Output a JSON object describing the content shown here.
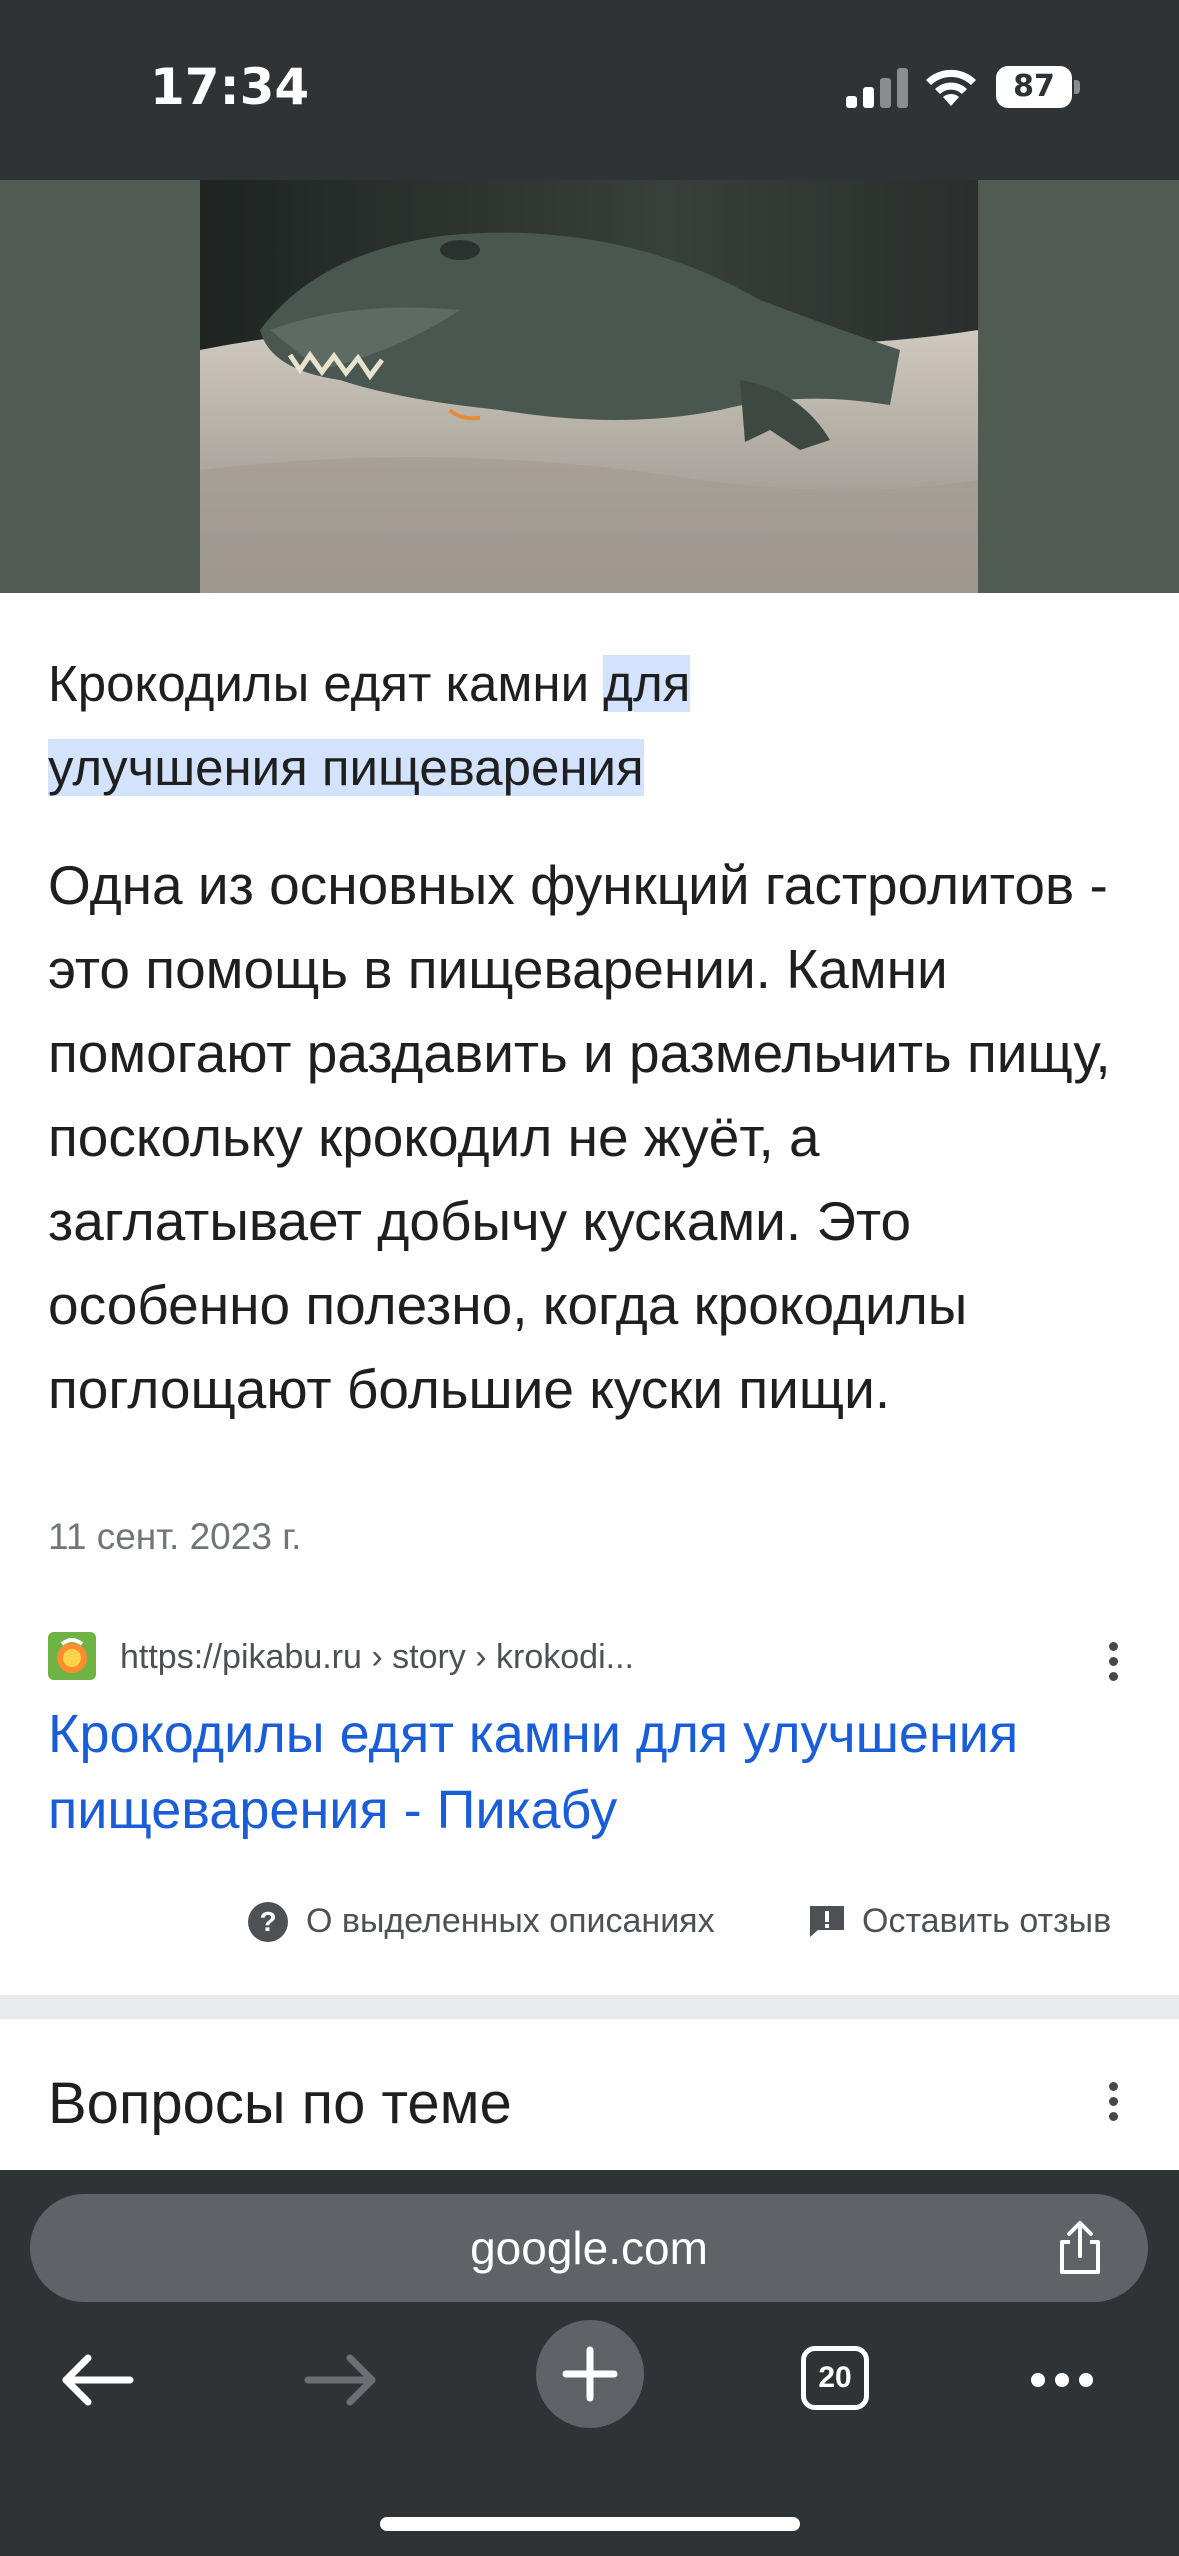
{
  "status_bar": {
    "time": "17:34",
    "battery": "87",
    "icons": [
      "signal-icon",
      "wifi-icon",
      "battery-icon"
    ]
  },
  "hero_image": {
    "subject": "crocodile-photo"
  },
  "snippet": {
    "title_plain": "Крокодилы едят камни ",
    "title_highlight_1": "для",
    "title_highlight_2": "улучшения пищеварения",
    "text": "Одна из основных функций гастролитов - это помощь в пищеварении. Камни помогают раздавить и размельчить пищу, поскольку крокодил не жуёт, а заглатывает добычу кусками. Это особенно полезно, когда крокодилы поглощают большие куски пищи.",
    "date": "11 сент. 2023 г."
  },
  "result": {
    "url": "https://pikabu.ru › story › krokodi...",
    "link_title": "Крокодилы едят камни для улучшения пищеварения - Пикабу"
  },
  "feedback": {
    "about_label": "О выделенных описаниях",
    "feedback_label": "Оставить отзыв"
  },
  "related": {
    "title": "Вопросы по теме"
  },
  "toolbar": {
    "url": "google.com",
    "tab_count": "20"
  },
  "colors": {
    "link": "#1a5dd8",
    "highlight": "#d3e3fd",
    "chrome_dark": "#303336"
  }
}
